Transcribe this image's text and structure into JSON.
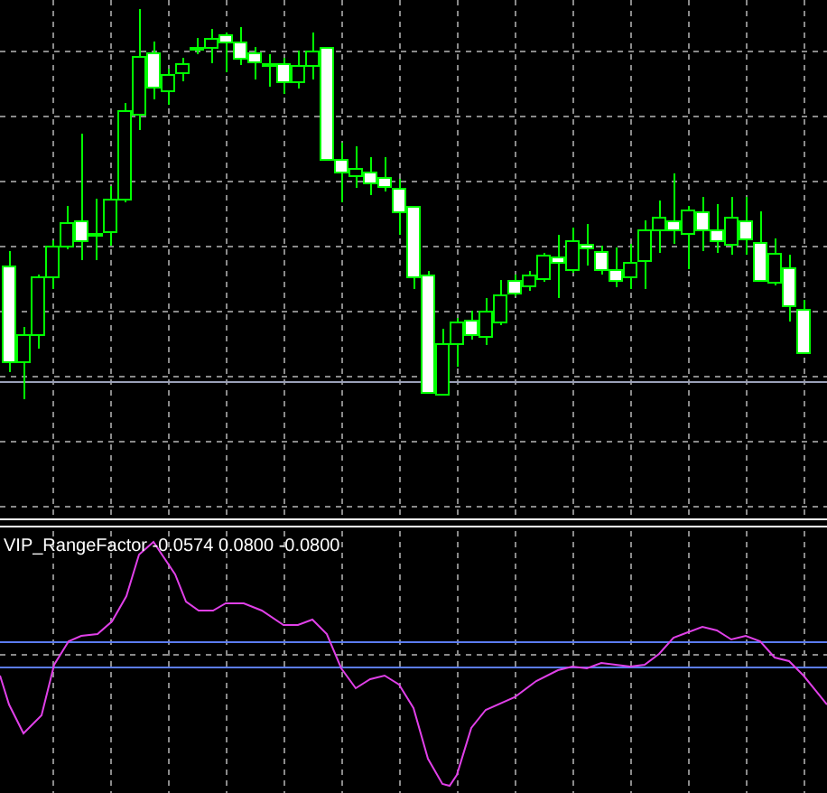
{
  "indicator_panel": {
    "label": "VIP_RangeFactor -0.0574 0.0800 -0.0800"
  }
}
